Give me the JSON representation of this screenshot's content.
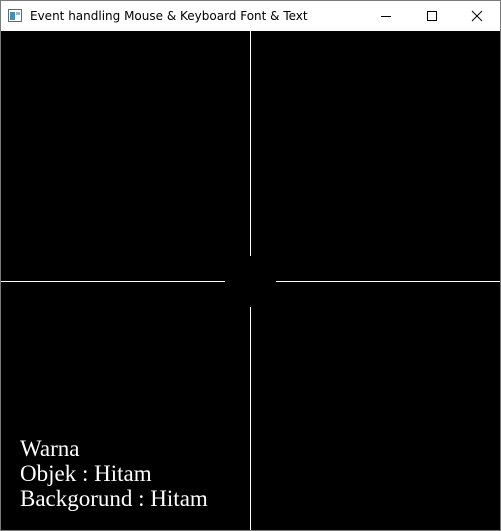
{
  "window": {
    "title": "Event handling Mouse & Keyboard Font & Text",
    "icons": {
      "app": "app-window-icon",
      "minimize": "minimize-icon",
      "maximize": "maximize-icon",
      "close": "close-icon"
    }
  },
  "canvas": {
    "background": "#000000",
    "line_color": "#ffffff",
    "text_color": "#ffffff",
    "crosshair": "crosshair-lines",
    "lines": [
      "Warna",
      "Objek : Hitam",
      "Backgorund : Hitam"
    ]
  }
}
